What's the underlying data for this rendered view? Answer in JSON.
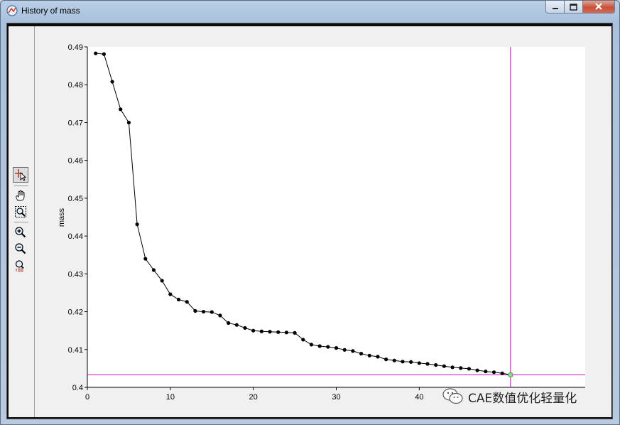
{
  "window": {
    "title": "History of mass",
    "icons": {
      "app": "chart-app-icon",
      "minimize": "minimize-icon",
      "maximize": "maximize-icon",
      "close": "close-icon"
    }
  },
  "toolbar": {
    "tools": [
      {
        "name": "crosshair-select-tool",
        "icon": "crosshair-cursor-icon",
        "active": true
      },
      {
        "name": "pan-tool",
        "icon": "hand-icon",
        "active": false
      },
      {
        "name": "zoom-box-tool",
        "icon": "zoom-box-icon",
        "active": false
      },
      {
        "name": "zoom-in-tool",
        "icon": "zoom-in-icon",
        "active": false
      },
      {
        "name": "zoom-out-tool",
        "icon": "zoom-out-icon",
        "active": false
      },
      {
        "name": "zoom-reset-tool",
        "icon": "zoom-100-icon",
        "active": false
      }
    ]
  },
  "watermark": {
    "text": "CAE数值优化轻量化",
    "icon": "wechat-icon"
  },
  "chart_data": {
    "type": "line",
    "title": "",
    "xlabel": "",
    "ylabel": "mass",
    "xlim": [
      0,
      60
    ],
    "ylim": [
      0.4,
      0.49
    ],
    "xticks": [
      0,
      10,
      20,
      30,
      40
    ],
    "xtick_labels": [
      "0",
      "10",
      "20",
      "30",
      "40"
    ],
    "yticks": [
      0.4,
      0.41,
      0.42,
      0.43,
      0.44,
      0.45,
      0.46,
      0.47,
      0.48,
      0.49
    ],
    "ytick_labels": [
      "0.4",
      "0.41",
      "0.42",
      "0.43",
      "0.44",
      "0.45",
      "0.46",
      "0.47",
      "0.48",
      "0.49"
    ],
    "grid": false,
    "marker": "circle",
    "line_color": "#000000",
    "cursor_color": "#cc00cc",
    "highlight_color": "#8ed68a",
    "cursor": {
      "x": 51,
      "y": 0.4033
    },
    "series": [
      {
        "x": [
          1,
          2,
          3,
          4,
          5,
          6,
          7,
          8,
          9,
          10,
          11,
          12,
          13,
          14,
          15,
          16,
          17,
          18,
          19,
          20,
          21,
          22,
          23,
          24,
          25,
          26,
          27,
          28,
          29,
          30,
          31,
          32,
          33,
          34,
          35,
          36,
          37,
          38,
          39,
          40,
          41,
          42,
          43,
          44,
          45,
          46,
          47,
          48,
          49,
          50,
          51
        ],
        "values": [
          0.4883,
          0.4881,
          0.4808,
          0.4735,
          0.47,
          0.4431,
          0.434,
          0.431,
          0.4282,
          0.4246,
          0.4232,
          0.4226,
          0.4202,
          0.42,
          0.4199,
          0.419,
          0.417,
          0.4165,
          0.4157,
          0.415,
          0.4148,
          0.4147,
          0.4146,
          0.4145,
          0.4144,
          0.4126,
          0.4113,
          0.4109,
          0.4107,
          0.4104,
          0.4099,
          0.4096,
          0.4089,
          0.4084,
          0.4081,
          0.4074,
          0.4071,
          0.4068,
          0.4067,
          0.4064,
          0.4062,
          0.4059,
          0.4056,
          0.4053,
          0.4051,
          0.4049,
          0.4045,
          0.4042,
          0.404,
          0.4037,
          0.4033
        ]
      }
    ]
  }
}
